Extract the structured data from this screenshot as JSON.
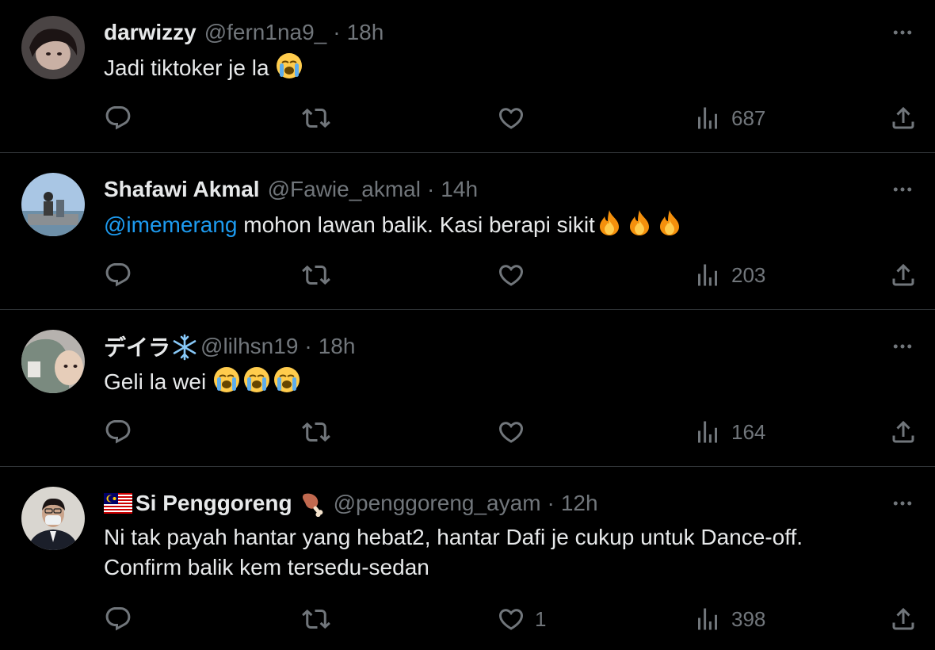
{
  "tweets": [
    {
      "name": "darwizzy",
      "handle": "@fern1na9_",
      "separator": "·",
      "time": "18h",
      "text": "Jadi tiktoker je la",
      "emoji": [
        "loudly-crying-face"
      ],
      "views": "687",
      "likes": ""
    },
    {
      "name": "Shafawi Akmal",
      "handle": "@Fawie_akmal",
      "separator": "·",
      "time": "14h",
      "mention": "@imemerang",
      "text": " mohon lawan balik. Kasi berapi sikit",
      "emoji": [
        "fire",
        "fire",
        "fire"
      ],
      "views": "203",
      "likes": ""
    },
    {
      "name": "デイラ",
      "name_emoji": "snowflake",
      "handle": "@lilhsn19",
      "separator": "·",
      "time": "18h",
      "text": "Geli la wei ",
      "emoji": [
        "loudly-crying-face",
        "loudly-crying-face",
        "loudly-crying-face"
      ],
      "views": "164",
      "likes": ""
    },
    {
      "name_prefix_emoji": "malaysia-flag",
      "name": "Si Penggoreng",
      "name_emoji": "poultry-leg",
      "handle": "@penggoreng_ayam",
      "separator": "·",
      "time": "12h",
      "text_line1": "Ni tak payah hantar yang hebat2, hantar Dafi je cukup untuk Dance-off.",
      "text_line2": "Confirm balik kem tersedu-sedan",
      "views": "398",
      "likes": "1"
    }
  ],
  "colors": {
    "background": "#000000",
    "text": "#e7e9ea",
    "muted": "#71767b",
    "link": "#1d9bf0",
    "divider": "#2f3336"
  }
}
